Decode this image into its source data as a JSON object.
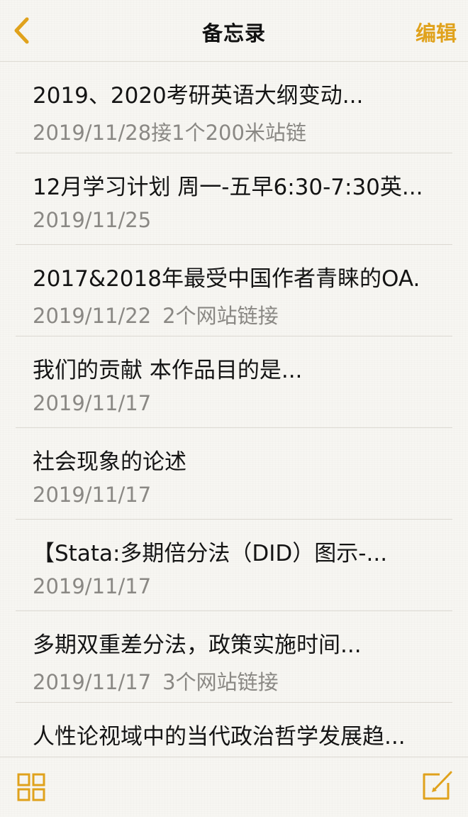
{
  "nav": {
    "back_icon": "chevron-left-icon",
    "title": "备忘录",
    "edit_label": "编辑",
    "accent_color": "#e0a21c"
  },
  "notes": [
    {
      "title": "2019、2020考研英语大纲变动...",
      "date": "2019/11/28",
      "extra": "接1个200米站链"
    },
    {
      "title": "12月学习计划 周一-五早6:30-7:30英...",
      "date": "2019/11/25",
      "extra": ""
    },
    {
      "title": "2017&2018年最受中国作者青睐的OA.",
      "date": "2019/11/22",
      "extra": "2个网站链接"
    },
    {
      "title": "我们的贡献  本作品目的是...",
      "date": "2019/11/17",
      "extra": ""
    },
    {
      "title": "社会现象的论述",
      "date": "2019/11/17",
      "extra": ""
    },
    {
      "title": "【Stata:多期倍分法（DID）图示-...",
      "date": "2019/11/17",
      "extra": ""
    },
    {
      "title": "多期双重差分法，政策实施时间...",
      "date": "2019/11/17",
      "extra": "3个网站链接"
    },
    {
      "title": "人性论视域中的当代政治哲学发展趋...",
      "date": "",
      "extra": ""
    }
  ],
  "toolbar": {
    "grid_icon": "grid-icon",
    "compose_icon": "compose-icon"
  }
}
